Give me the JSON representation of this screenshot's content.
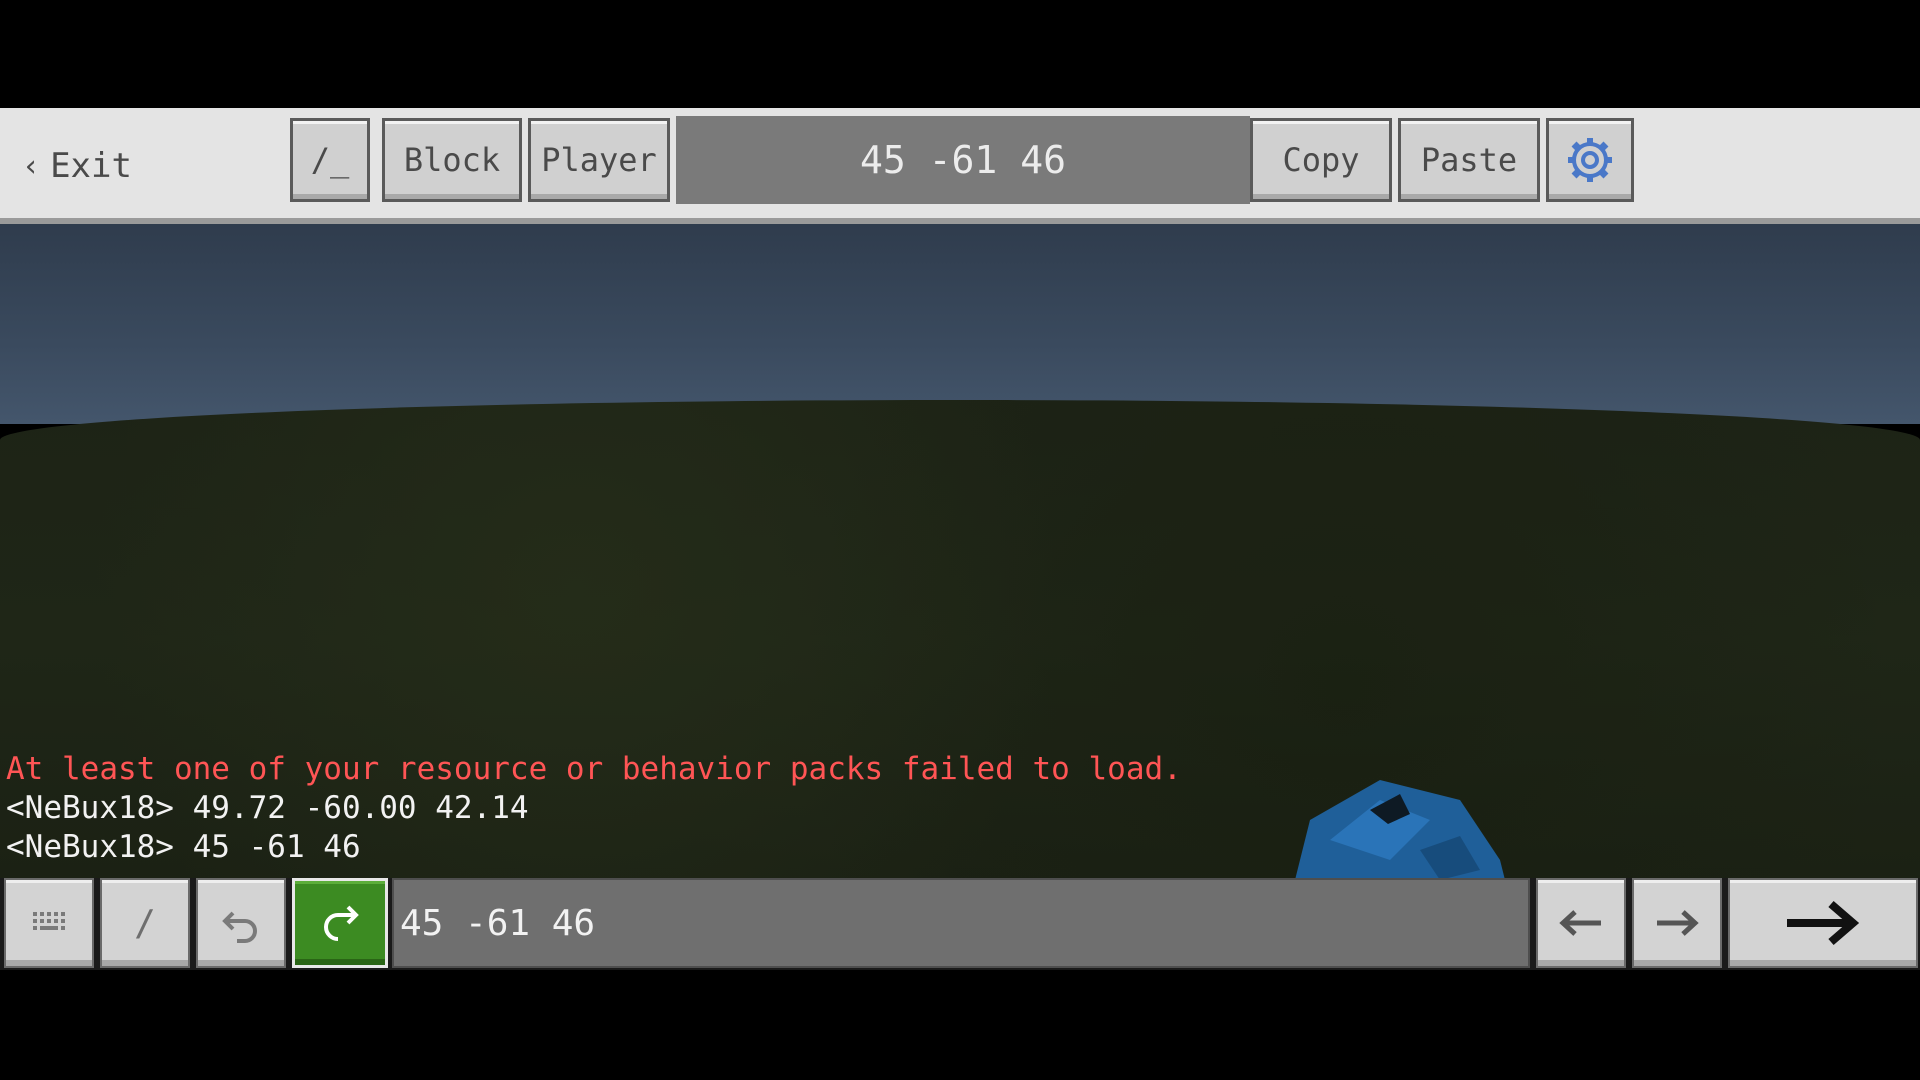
{
  "top_toolbar": {
    "exit_label": "Exit",
    "slash_label": "/_",
    "block_label": "Block",
    "player_label": "Player",
    "coordinates": "45 -61 46",
    "copy_label": "Copy",
    "paste_label": "Paste",
    "settings_icon": "gear-icon"
  },
  "chat": {
    "lines": [
      {
        "text": "At least one of your resource or behavior packs failed to load.",
        "color": "#ff5555"
      },
      {
        "text": "<NeBux18> 49.72 -60.00 42.14",
        "color": "#f2f2f2"
      },
      {
        "text": "<NeBux18> 45 -61 46",
        "color": "#f2f2f2"
      }
    ]
  },
  "bottom_bar": {
    "keyboard_icon": "keyboard-icon",
    "slash_label": "/",
    "undo_icon": "undo-icon",
    "redo_icon": "redo-icon",
    "command_value": "45 -61 46",
    "prev_icon": "arrow-left-icon",
    "next_icon": "arrow-right-icon",
    "send_icon": "send-arrow-icon"
  },
  "colors": {
    "accent_green": "#3c8b22",
    "warning_red": "#ff5555"
  }
}
